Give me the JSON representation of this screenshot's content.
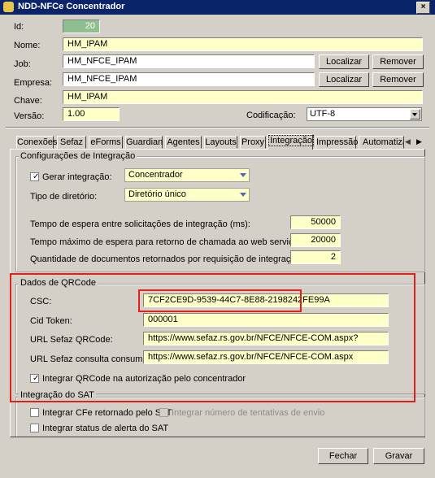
{
  "window": {
    "title": "NDD-NFCe Concentrador",
    "close": "×"
  },
  "header": {
    "id_label": "Id:",
    "id_value": "20",
    "nome_label": "Nome:",
    "nome_value": "HM_IPAM",
    "job_label": "Job:",
    "job_value": "HM_NFCE_IPAM",
    "empresa_label": "Empresa:",
    "empresa_value": "HM_NFCE_IPAM",
    "chave_label": "Chave:",
    "chave_value": "HM_IPAM",
    "versao_label": "Versão:",
    "versao_value": "1.00",
    "codificacao_label": "Codificação:",
    "codificacao_value": "UTF-8",
    "localizar": "Localizar",
    "remover": "Remover"
  },
  "tabs": [
    "Conexões",
    "Sefaz",
    "eForms",
    "Guardian",
    "Agentes",
    "Layouts",
    "Proxy",
    "Integração",
    "Impressão",
    "Automatizaç"
  ],
  "active_tab": "Integração",
  "config": {
    "legend": "Configurações de Integração",
    "gerar_label": "Gerar integração:",
    "gerar_checked": true,
    "gerar_value": "Concentrador",
    "tipo_label": "Tipo de diretório:",
    "tipo_value": "Diretório único",
    "tempo_label": "Tempo de espera entre solicitações de integração (ms):",
    "tempo_value": "50000",
    "tempo_max_label": "Tempo máximo de espera para retorno de chamada ao web service (ms):",
    "tempo_max_value": "20000",
    "qtd_label": "Quantidade de documentos retornados por requisição de integração:",
    "qtd_value": "2"
  },
  "qrcode": {
    "legend": "Dados de QRCode",
    "csc_label": "CSC:",
    "csc_value": "7CF2CE9D-9539-44C7-8E88-2198242FE99A",
    "cid_label": "Cid Token:",
    "cid_value": "000001",
    "url_label": "URL Sefaz QRCode:",
    "url_value": "https://www.sefaz.rs.gov.br/NFCE/NFCE-COM.aspx?",
    "url_consulta_label": "URL Sefaz consulta consumidor:",
    "url_consulta_value": "https://www.sefaz.rs.gov.br/NFCE/NFCE-COM.aspx",
    "integrar_label": "Integrar QRCode na autorização pelo concentrador",
    "integrar_checked": true
  },
  "sat": {
    "legend": "Integração do SAT",
    "cfe_label": "Integrar CFe retornado pelo SAT",
    "tentativas_label": "Integrar número de tentativas de envio",
    "status_label": "Integrar status de alerta do SAT"
  },
  "footer": {
    "fechar": "Fechar",
    "gravar": "Gravar"
  },
  "colors": {
    "highlight": "#e0201a",
    "field": "#ffffc8",
    "title": "#0a246a"
  }
}
